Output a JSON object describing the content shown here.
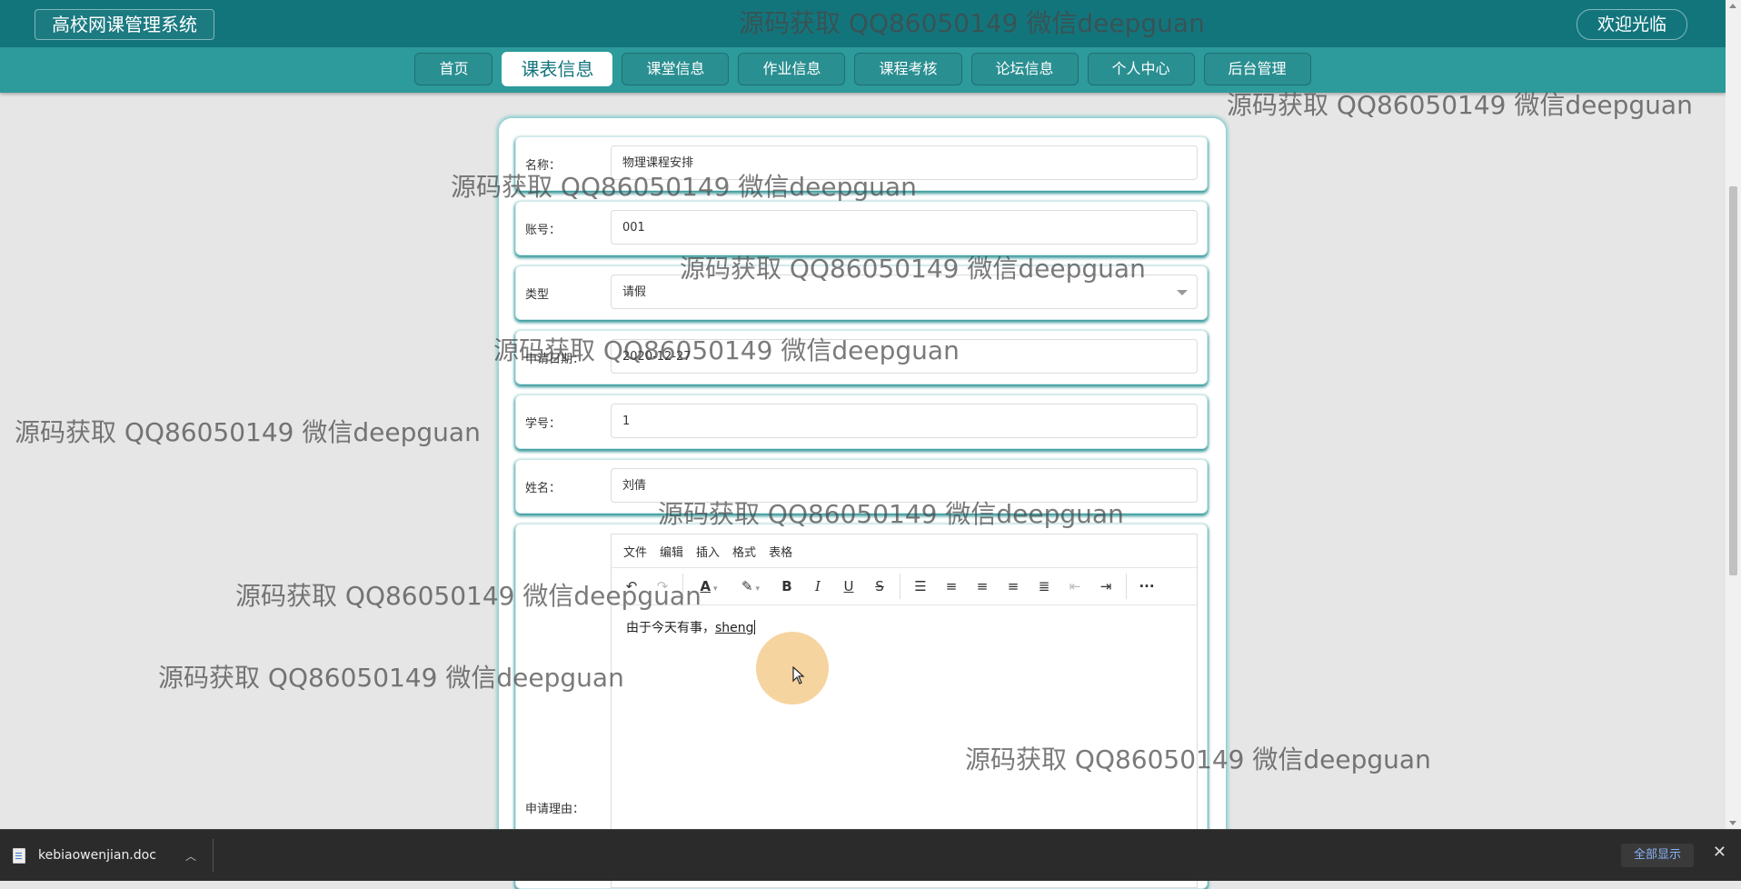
{
  "header": {
    "brand": "高校网课管理系统",
    "welcome": "欢迎光临"
  },
  "nav": {
    "items": [
      {
        "label": "首页",
        "active": false
      },
      {
        "label": "课表信息",
        "active": true
      },
      {
        "label": "课堂信息",
        "active": false
      },
      {
        "label": "作业信息",
        "active": false
      },
      {
        "label": "课程考核",
        "active": false
      },
      {
        "label": "论坛信息",
        "active": false
      },
      {
        "label": "个人中心",
        "active": false
      },
      {
        "label": "后台管理",
        "active": false
      }
    ]
  },
  "form": {
    "name": {
      "label": "名称：",
      "value": "物理课程安排"
    },
    "account": {
      "label": "账号：",
      "value": "001"
    },
    "type": {
      "label": "类型",
      "value": "请假"
    },
    "date": {
      "label": "申请日期：",
      "value": "2020-12-27"
    },
    "student_id": {
      "label": "学号：",
      "value": "1"
    },
    "student_name": {
      "label": "姓名：",
      "value": "刘倩"
    },
    "reason": {
      "label": "申请理由："
    }
  },
  "editor": {
    "menus": [
      "文件",
      "编辑",
      "插入",
      "格式",
      "表格"
    ],
    "content_text": "由于今天有事，",
    "content_typing": "sheng"
  },
  "watermark": "源码获取 QQ86050149 微信deepguan",
  "download": {
    "filename": "kebiaowenjian.doc",
    "show_all": "全部显示"
  },
  "colors": {
    "topbar": "#13757c",
    "navbar": "#2d9a9b",
    "panel_shadow": "#3a9a9c"
  }
}
